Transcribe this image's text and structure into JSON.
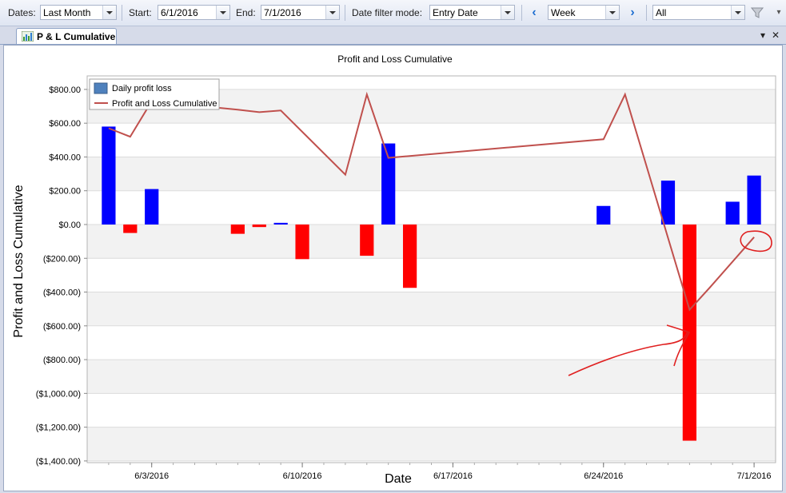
{
  "toolbar": {
    "dates_label": "Dates:",
    "dates_value": "Last Month",
    "start_label": "Start:",
    "start_value": "6/1/2016",
    "end_label": "End:",
    "end_value": "7/1/2016",
    "mode_label": "Date filter mode:",
    "mode_value": "Entry Date",
    "period_value": "Week",
    "account_value": "All",
    "prev_icon": "chevron-left-icon",
    "next_icon": "chevron-right-icon",
    "filter_icon": "filter-icon"
  },
  "tab": {
    "label": "P & L Cumulative",
    "icon": "chart-icon",
    "menu_icon": "▾",
    "close_icon": "✕"
  },
  "colors": {
    "bar_positive": "#0000ff",
    "bar_negative": "#ff0000",
    "line": "#c0504d",
    "annotation": "#e02020"
  },
  "chart_data": {
    "type": "bar",
    "title": "Profit and Loss Cumulative",
    "xlabel": "Date",
    "ylabel": "Profit and Loss Cumulative",
    "ylim": [
      -1500,
      800
    ],
    "yticks": [
      "$800.00",
      "$600.00",
      "$400.00",
      "$200.00",
      "$0.00",
      "($200.00)",
      "($400.00)",
      "($600.00)",
      "($800.00)",
      "($1,000.00)",
      "($1,200.00)",
      "($1,400.00)"
    ],
    "xticks": [
      "6/3/2016",
      "6/10/2016",
      "6/17/2016",
      "6/24/2016",
      "7/1/2016"
    ],
    "x_start": "2016-05-31",
    "x_end": "2016-07-02",
    "legend": {
      "position": "top-left"
    },
    "series": [
      {
        "name": "Daily profit loss",
        "type": "bar",
        "points": [
          {
            "date": "2016-06-01",
            "value": 580
          },
          {
            "date": "2016-06-02",
            "value": -50
          },
          {
            "date": "2016-06-03",
            "value": 210
          },
          {
            "date": "2016-06-07",
            "value": -55
          },
          {
            "date": "2016-06-08",
            "value": -15
          },
          {
            "date": "2016-06-09",
            "value": 10
          },
          {
            "date": "2016-06-10",
            "value": -205
          },
          {
            "date": "2016-06-13",
            "value": -185
          },
          {
            "date": "2016-06-14",
            "value": 480
          },
          {
            "date": "2016-06-15",
            "value": -375
          },
          {
            "date": "2016-06-24",
            "value": 110
          },
          {
            "date": "2016-06-27",
            "value": 260
          },
          {
            "date": "2016-06-28",
            "value": -1280
          },
          {
            "date": "2016-06-30",
            "value": 135
          },
          {
            "date": "2016-07-01",
            "value": 290
          }
        ]
      },
      {
        "name": "Profit and Loss Cumulative",
        "type": "line",
        "points": [
          {
            "date": "2016-06-01",
            "value": 570
          },
          {
            "date": "2016-06-02",
            "value": 520
          },
          {
            "date": "2016-06-03",
            "value": 730
          },
          {
            "date": "2016-06-07",
            "value": 680
          },
          {
            "date": "2016-06-08",
            "value": 665
          },
          {
            "date": "2016-06-09",
            "value": 675
          },
          {
            "date": "2016-06-12",
            "value": 295
          },
          {
            "date": "2016-06-13",
            "value": 770
          },
          {
            "date": "2016-06-14",
            "value": 395
          },
          {
            "date": "2016-06-24",
            "value": 505
          },
          {
            "date": "2016-06-25",
            "value": 770
          },
          {
            "date": "2016-06-28",
            "value": -505
          },
          {
            "date": "2016-06-29",
            "value": -365
          },
          {
            "date": "2016-07-01",
            "value": -75
          }
        ]
      }
    ]
  }
}
